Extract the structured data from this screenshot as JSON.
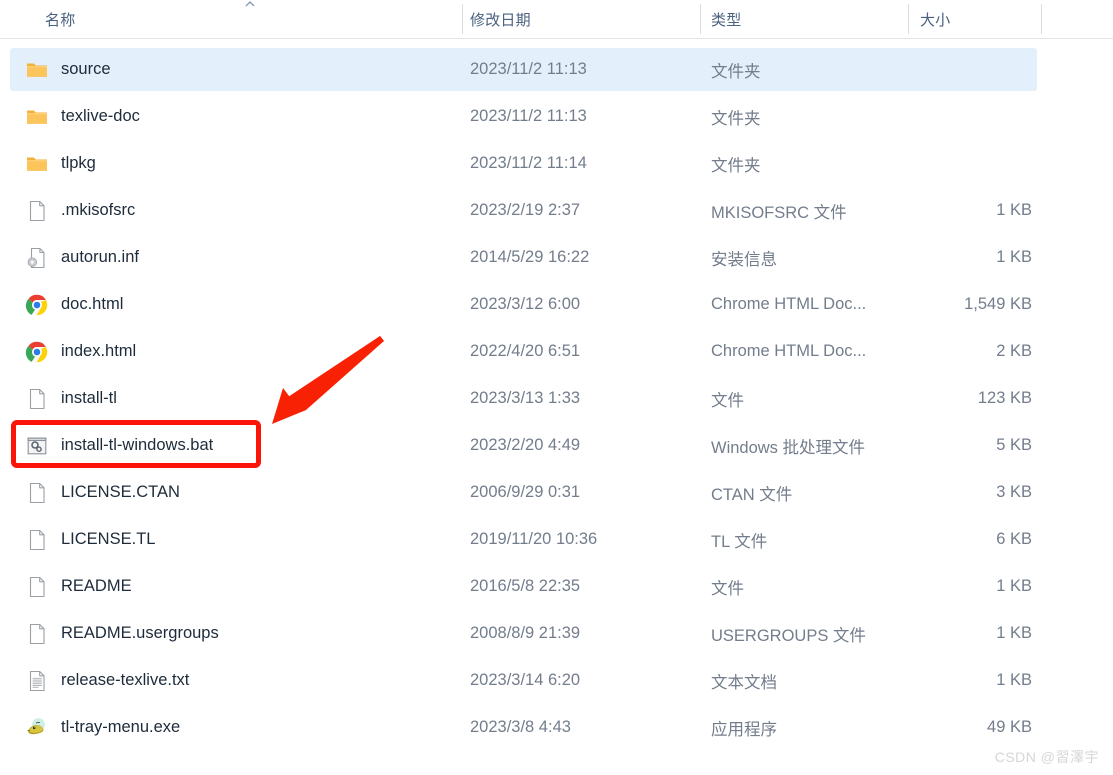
{
  "header": {
    "columns": [
      {
        "label": "名称",
        "name": "column-header-name"
      },
      {
        "label": "修改日期",
        "name": "column-header-date-modified"
      },
      {
        "label": "类型",
        "name": "column-header-type"
      },
      {
        "label": "大小",
        "name": "column-header-size"
      }
    ],
    "sort_indicator": "⌃"
  },
  "rows": [
    {
      "name": "source",
      "date": "2023/11/2 11:13",
      "type": "文件夹",
      "size": "",
      "icon": "folder-icon",
      "selected": true
    },
    {
      "name": "texlive-doc",
      "date": "2023/11/2 11:13",
      "type": "文件夹",
      "size": "",
      "icon": "folder-icon",
      "selected": false
    },
    {
      "name": "tlpkg",
      "date": "2023/11/2 11:14",
      "type": "文件夹",
      "size": "",
      "icon": "folder-icon",
      "selected": false
    },
    {
      "name": ".mkisofsrc",
      "date": "2023/2/19 2:37",
      "type": "MKISOFSRC 文件",
      "size": "1 KB",
      "icon": "blank-file-icon",
      "selected": false
    },
    {
      "name": "autorun.inf",
      "date": "2014/5/29 16:22",
      "type": "安装信息",
      "size": "1 KB",
      "icon": "setup-info-icon",
      "selected": false
    },
    {
      "name": "doc.html",
      "date": "2023/3/12 6:00",
      "type": "Chrome HTML Doc...",
      "size": "1,549 KB",
      "icon": "chrome-icon",
      "selected": false
    },
    {
      "name": "index.html",
      "date": "2022/4/20 6:51",
      "type": "Chrome HTML Doc...",
      "size": "2 KB",
      "icon": "chrome-icon",
      "selected": false
    },
    {
      "name": "install-tl",
      "date": "2023/3/13 1:33",
      "type": "文件",
      "size": "123 KB",
      "icon": "blank-file-icon",
      "selected": false
    },
    {
      "name": "install-tl-windows.bat",
      "date": "2023/2/20 4:49",
      "type": "Windows 批处理文件",
      "size": "5 KB",
      "icon": "batch-file-icon",
      "selected": false
    },
    {
      "name": "LICENSE.CTAN",
      "date": "2006/9/29 0:31",
      "type": "CTAN 文件",
      "size": "3 KB",
      "icon": "blank-file-icon",
      "selected": false
    },
    {
      "name": "LICENSE.TL",
      "date": "2019/11/20 10:36",
      "type": "TL 文件",
      "size": "6 KB",
      "icon": "blank-file-icon",
      "selected": false
    },
    {
      "name": "README",
      "date": "2016/5/8 22:35",
      "type": "文件",
      "size": "1 KB",
      "icon": "blank-file-icon",
      "selected": false
    },
    {
      "name": "README.usergroups",
      "date": "2008/8/9 21:39",
      "type": "USERGROUPS 文件",
      "size": "1 KB",
      "icon": "blank-file-icon",
      "selected": false
    },
    {
      "name": "release-texlive.txt",
      "date": "2023/3/14 6:20",
      "type": "文本文档",
      "size": "1 KB",
      "icon": "text-document-icon",
      "selected": false
    },
    {
      "name": "tl-tray-menu.exe",
      "date": "2023/3/8 4:43",
      "type": "应用程序",
      "size": "49 KB",
      "icon": "tl-tray-menu-app-icon",
      "selected": false
    }
  ],
  "annotations": {
    "highlight_target": "install-tl-windows.bat",
    "rect_color": "#fc1408",
    "arrow_color": "#f92104"
  },
  "watermark": {
    "text": "CSDN @習澤宇"
  },
  "colors": {
    "selection": "#e3f0fb",
    "header_text": "#4a6180",
    "cell_text": "#737d8c",
    "name_text": "#1d2b3a",
    "folder": "#ffc societies"
  }
}
